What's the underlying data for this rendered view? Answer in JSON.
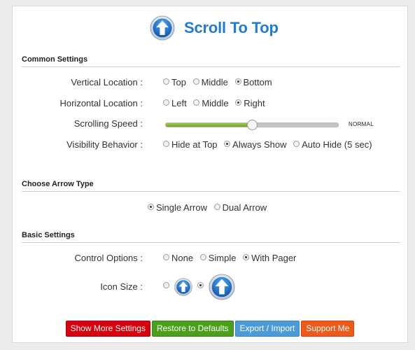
{
  "header": {
    "title": "Scroll To Top",
    "logo_icon": "arrow-up-circle-icon"
  },
  "common": {
    "title": "Common Settings",
    "vertical": {
      "label": "Vertical Location :",
      "options": [
        "Top",
        "Middle",
        "Bottom"
      ],
      "selected": 2
    },
    "horizontal": {
      "label": "Horizontal Location :",
      "options": [
        "Left",
        "Middle",
        "Right"
      ],
      "selected": 2
    },
    "speed": {
      "label": "Scrolling Speed :",
      "value_label": "NORMAL",
      "level": 0.5
    },
    "visibility": {
      "label": "Visibility Behavior :",
      "options": [
        "Hide at Top",
        "Always Show",
        "Auto Hide (5 sec)"
      ],
      "selected": 1
    }
  },
  "arrow_type": {
    "title": "Choose Arrow Type",
    "options": [
      "Single Arrow",
      "Dual Arrow"
    ],
    "selected": 0
  },
  "basic": {
    "title": "Basic Settings",
    "control": {
      "label": "Control Options :",
      "options": [
        "None",
        "Simple",
        "With Pager"
      ],
      "selected": 2
    },
    "icon_size": {
      "label": "Icon Size :",
      "options": [
        "small-arrow-icon",
        "large-arrow-icon"
      ],
      "selected": 1
    }
  },
  "buttons": {
    "show_more": "Show More Settings",
    "restore": "Restore to Defaults",
    "export_import": "Export / Import",
    "support": "Support Me"
  },
  "colors": {
    "accent": "#1f7ccf",
    "slider_green": "#7cb82b",
    "btn_red": "#d9000d",
    "btn_green": "#4aa01a",
    "btn_blue": "#4a9bd8",
    "btn_orange": "#ef5a1b"
  }
}
